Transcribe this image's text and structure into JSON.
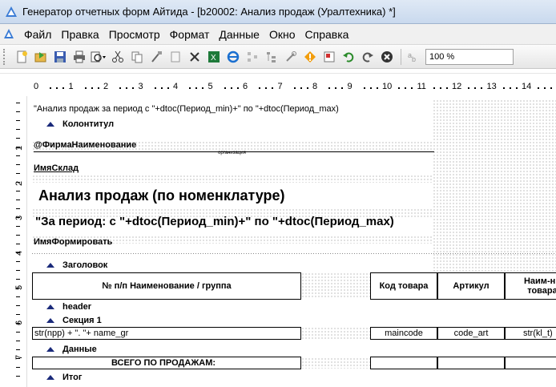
{
  "window": {
    "title": "Генератор отчетных форм Айтида - [b20002: Анализ продаж (Уралтехника) *]"
  },
  "menu": {
    "items": [
      "Файл",
      "Правка",
      "Просмотр",
      "Формат",
      "Данные",
      "Окно",
      "Справка"
    ]
  },
  "toolbar": {
    "buttons": [
      "new-icon",
      "open-icon",
      "save-icon",
      "print-icon",
      "preview-icon",
      "cut-icon",
      "copy-icon",
      "paste-format-icon",
      "blank-icon",
      "delete-icon",
      "excel-icon",
      "ie-icon",
      "flow-icon",
      "tree-icon",
      "tools-icon",
      "warning-icon",
      "properties-icon",
      "undo-icon",
      "redo-icon",
      "stop-icon",
      "text-icon"
    ],
    "zoom_value": "100 %"
  },
  "ruler": {
    "labels": [
      "0",
      "1",
      "2",
      "3",
      "4",
      "5",
      "6",
      "7",
      "8",
      "9",
      "10",
      "11",
      "12",
      "13",
      "14"
    ],
    "vlabels": [
      "1",
      "2",
      "3",
      "4",
      "5",
      "6",
      "7"
    ]
  },
  "report": {
    "period_expr": "\"Анализ продаж за период с \"+dtoc(Период_min)+\" по \"+dtoc(Период_max)",
    "band_kolontitul": "Колонтитул",
    "firm_name": "@ФирмаНаименование",
    "org_caption": "организация",
    "warehouse": "ИмяСклад",
    "title": "Анализ продаж (по номенклатуре)",
    "period_title": "\"За период: с \"+dtoc(Период_min)+\" по \"+dtoc(Период_max)",
    "formed_by": "ИмяФормировать",
    "band_zagolovok": "Заголовок",
    "col_name": "№ п/п   Наименование / группа",
    "col_code": "Код товара",
    "col_article": "Артикул",
    "col_qty": "Наим-ни товара",
    "band_header": "header",
    "band_section": "Секция 1",
    "row_expr": "str(npp) + \".  \"+ name_gr",
    "row_code": "maincode",
    "row_article": "code_art",
    "row_qty": "str(kl_t)",
    "band_data": "Данные",
    "total_label": "ВСЕГО ПО ПРОДАЖАМ:",
    "band_itog": "Итог"
  }
}
